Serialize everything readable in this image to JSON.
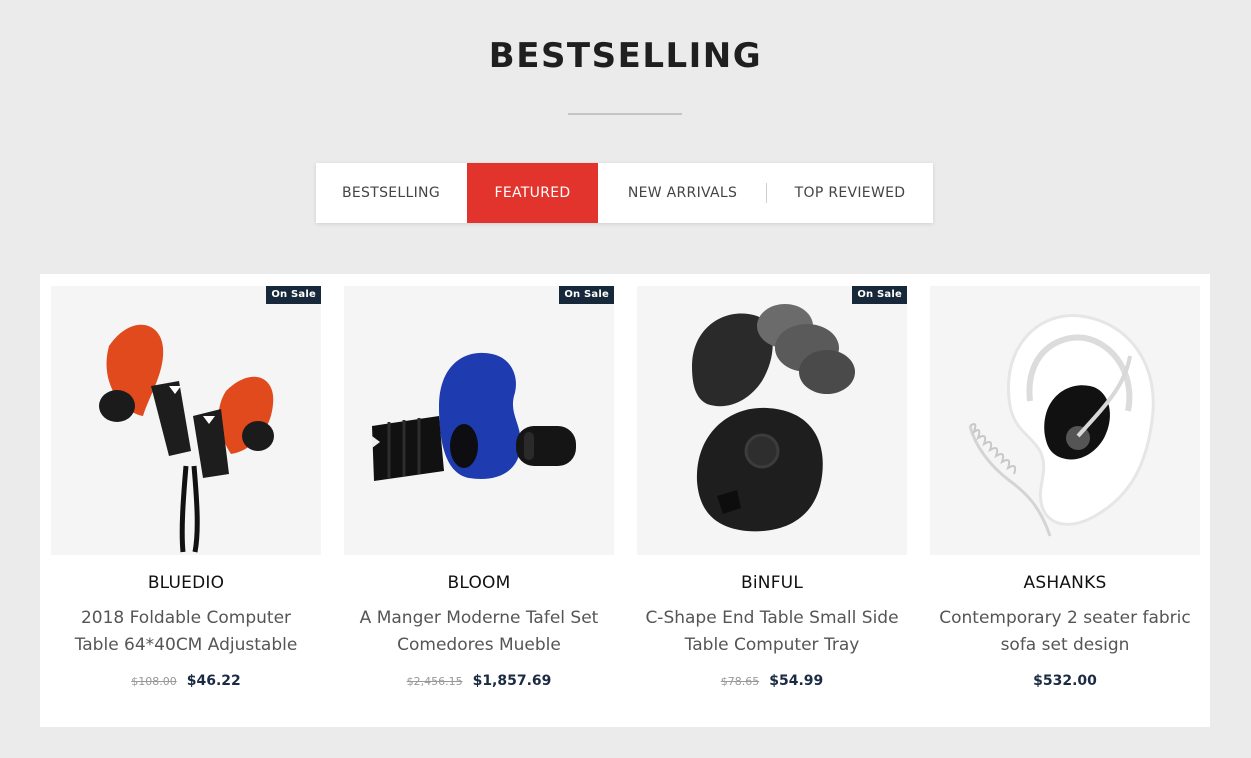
{
  "section": {
    "title": "BESTSELLING"
  },
  "tabs": [
    {
      "label": "BESTSELLING",
      "active": false
    },
    {
      "label": "FEATURED",
      "active": true
    },
    {
      "label": "NEW ARRIVALS",
      "active": false
    },
    {
      "label": "TOP REVIEWED",
      "active": false
    }
  ],
  "products": [
    {
      "badge": "On Sale",
      "brand": "BLUEDIO",
      "name": "2018 Foldable Computer Table 64*40CM Adjustable",
      "old_price": "$108.00",
      "price": "$46.22",
      "image": "orange-earbuds-icon"
    },
    {
      "badge": "On Sale",
      "brand": "BLOOM",
      "name": "A Manger Moderne Tafel Set Comedores Mueble",
      "old_price": "$2,456.15",
      "price": "$1,857.69",
      "image": "blue-earplug-icon"
    },
    {
      "badge": "On Sale",
      "brand": "BiNFUL",
      "name": "C-Shape End Table Small Side Table Computer Tray",
      "old_price": "$78.65",
      "price": "$54.99",
      "image": "black-earplugs-icon"
    },
    {
      "badge": "",
      "brand": "ASHANKS",
      "name": "Contemporary 2 seater fabric sofa set design",
      "old_price": "",
      "price": "$532.00",
      "image": "ear-monitor-icon"
    }
  ],
  "colors": {
    "accent": "#e2332c",
    "badge_bg": "#16283a",
    "price": "#1b2b44"
  }
}
